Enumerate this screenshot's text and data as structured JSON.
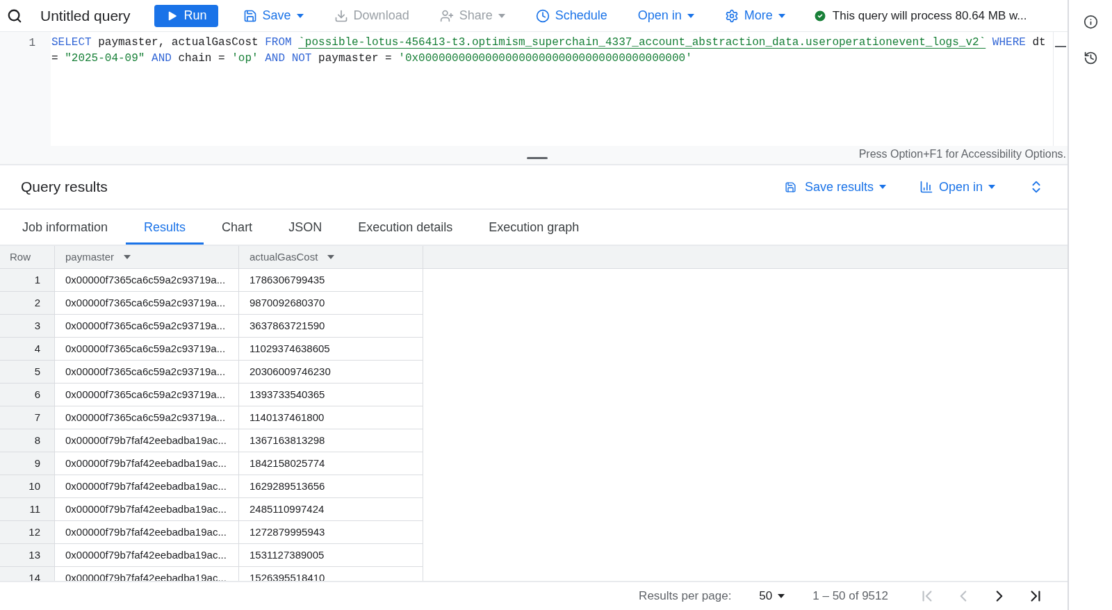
{
  "toolbar": {
    "title": "Untitled query",
    "buttons": [
      {
        "label": "Run",
        "kind": "primary",
        "disabled": false,
        "dropdown": false
      },
      {
        "label": "Save",
        "kind": "text",
        "disabled": false,
        "dropdown": true
      },
      {
        "label": "Download",
        "kind": "text",
        "disabled": true,
        "dropdown": false
      },
      {
        "label": "Share",
        "kind": "text",
        "disabled": true,
        "dropdown": true
      },
      {
        "label": "Schedule",
        "kind": "text",
        "disabled": false,
        "dropdown": false
      },
      {
        "label": "Open in",
        "kind": "text",
        "disabled": false,
        "dropdown": true
      },
      {
        "label": "More",
        "kind": "text",
        "disabled": false,
        "dropdown": true
      }
    ],
    "status": "This query will process 80.64 MB w..."
  },
  "editor": {
    "lines": [
      {
        "number": "1",
        "tokens": [
          {
            "kind": "keyword",
            "text": "SELECT"
          },
          {
            "kind": "plain",
            "text": " paymaster, actualGasCost "
          },
          {
            "kind": "keyword",
            "text": "FROM "
          },
          {
            "kind": "table",
            "text": "`possible-lotus-456413-t3.optimism_superchain_4337_account_abstraction_data.useroperationevent_logs_v2`"
          },
          {
            "kind": "keyword",
            "text": " WHERE"
          },
          {
            "kind": "plain",
            "text": " dt"
          }
        ]
      },
      {
        "tokens": [
          {
            "kind": "plain",
            "text": "= "
          },
          {
            "kind": "string",
            "text": "\"2025-04-09\""
          },
          {
            "kind": "keyword",
            "text": " AND"
          },
          {
            "kind": "plain",
            "text": " chain = "
          },
          {
            "kind": "string",
            "text": "'op'"
          },
          {
            "kind": "keyword",
            "text": " AND"
          },
          {
            "kind": "keyword",
            "text": " NOT"
          },
          {
            "kind": "plain",
            "text": " paymaster = "
          },
          {
            "kind": "string",
            "text": "'0x0000000000000000000000000000000000000000'"
          }
        ]
      }
    ],
    "hint": "Press Option+F1 for Accessibility Options."
  },
  "results": {
    "title": "Query results",
    "actions": [
      "Save results",
      "Open in"
    ],
    "tabs": [
      {
        "label": "Job information",
        "selected": false
      },
      {
        "label": "Results",
        "selected": true
      },
      {
        "label": "Chart",
        "selected": false
      },
      {
        "label": "JSON",
        "selected": false
      },
      {
        "label": "Execution details",
        "selected": false
      },
      {
        "label": "Execution graph",
        "selected": false
      }
    ],
    "table": {
      "columns": [
        "Row",
        "paymaster",
        "actualGasCost"
      ],
      "rows": [
        [
          "1",
          "0x00000f7365ca6c59a2c93719a...",
          "1786306799435"
        ],
        [
          "2",
          "0x00000f7365ca6c59a2c93719a...",
          "9870092680370"
        ],
        [
          "3",
          "0x00000f7365ca6c59a2c93719a...",
          "3637863721590"
        ],
        [
          "4",
          "0x00000f7365ca6c59a2c93719a...",
          "11029374638605"
        ],
        [
          "5",
          "0x00000f7365ca6c59a2c93719a...",
          "20306009746230"
        ],
        [
          "6",
          "0x00000f7365ca6c59a2c93719a...",
          "1393733540365"
        ],
        [
          "7",
          "0x00000f7365ca6c59a2c93719a...",
          "1140137461800"
        ],
        [
          "8",
          "0x00000f79b7faf42eebadba19ac...",
          "1367163813298"
        ],
        [
          "9",
          "0x00000f79b7faf42eebadba19ac...",
          "1842158025774"
        ],
        [
          "10",
          "0x00000f79b7faf42eebadba19ac...",
          "1629289513656"
        ],
        [
          "11",
          "0x00000f79b7faf42eebadba19ac...",
          "2485110997424"
        ],
        [
          "12",
          "0x00000f79b7faf42eebadba19ac...",
          "1272879995943"
        ],
        [
          "13",
          "0x00000f79b7faf42eebadba19ac...",
          "1531127389005"
        ],
        [
          "14",
          "0x00000f79b7faf42eebadba19ac...",
          "1526395518410"
        ]
      ]
    },
    "pagination": {
      "label": "Results per page:",
      "page_size": "50",
      "range": "1 – 50 of 9512",
      "first_disabled": true,
      "prev_disabled": true,
      "next_disabled": false,
      "last_disabled": false
    }
  }
}
